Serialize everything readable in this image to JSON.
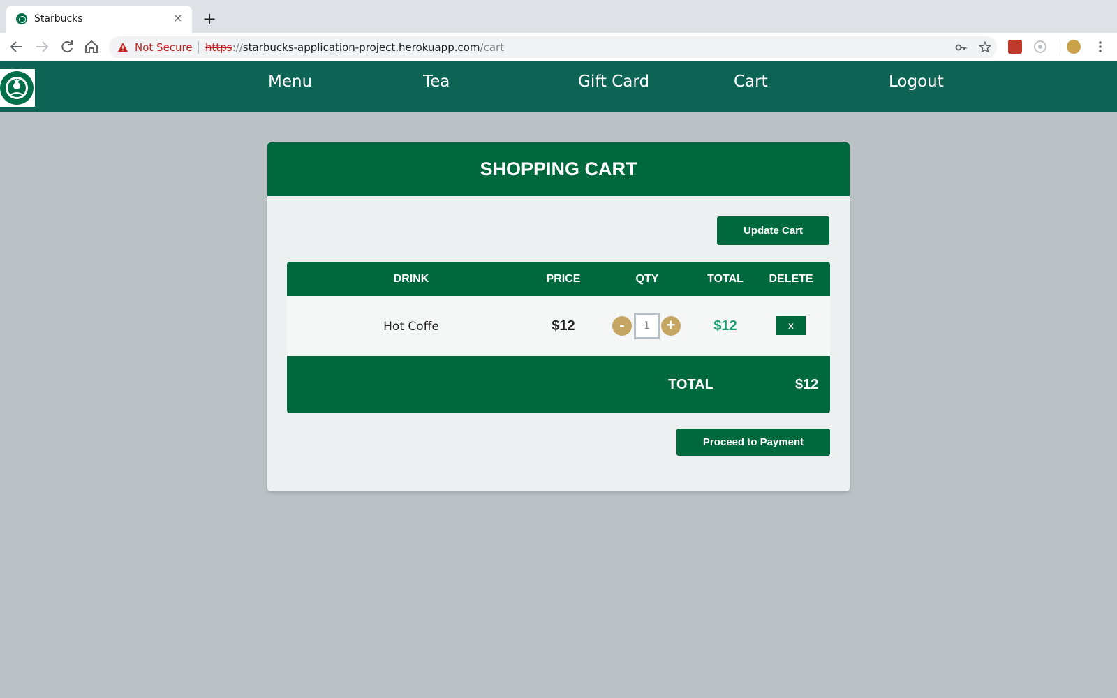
{
  "browser": {
    "tab_title": "Starbucks",
    "tab_close": "×",
    "new_tab": "+",
    "security_label": "Not Secure",
    "url_scheme": "https",
    "url_sep": "://",
    "url_host": "starbucks-application-project.herokuapp.com",
    "url_path": "/cart"
  },
  "nav": {
    "links": [
      "Menu",
      "Tea",
      "Gift Card",
      "Cart",
      "Logout"
    ]
  },
  "cart": {
    "title": "SHOPPING CART",
    "update_label": "Update Cart",
    "columns": [
      "DRINK",
      "PRICE",
      "QTY",
      "TOTAL",
      "DELETE"
    ],
    "items": [
      {
        "drink": "Hot Coffe",
        "price": "$12",
        "qty": "1",
        "total": "$12",
        "minus": "-",
        "plus": "+",
        "delete": "x"
      }
    ],
    "total_label": "TOTAL",
    "total_value": "$12",
    "pay_label": "Proceed to Payment"
  },
  "colors": {
    "header_bg": "#0d6354",
    "brand_green": "#00683d",
    "qty_gold": "#c5a663",
    "total_green": "#1aa06f"
  }
}
